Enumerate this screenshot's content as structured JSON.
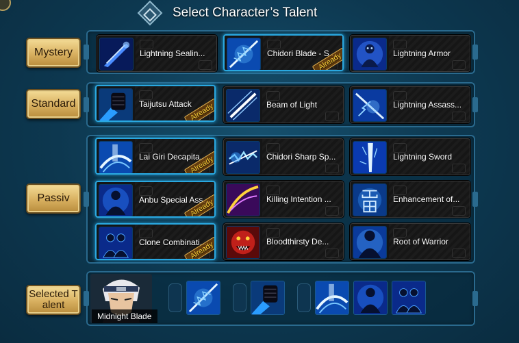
{
  "header": {
    "title": "Select Character’s Talent"
  },
  "categories": {
    "mystery": "Mystery",
    "standard": "Standard",
    "passive": "Passiv",
    "selected": "Selected T alent"
  },
  "already_label": "Already",
  "mystery_talents": [
    {
      "name": "Lightning Sealin...",
      "icon": "lightning-blade-icon",
      "selected": false,
      "already": false
    },
    {
      "name": "Chidori Blade - S...",
      "icon": "chidori-blade-icon",
      "selected": true,
      "already": true
    },
    {
      "name": "Lightning Armor",
      "icon": "lightning-armor-icon",
      "selected": false,
      "already": false
    }
  ],
  "standard_talents": [
    {
      "name": "Taijutsu Attack",
      "icon": "fist-icon",
      "selected": true,
      "already": true
    },
    {
      "name": "Beam of Light",
      "icon": "light-beam-icon",
      "selected": false,
      "already": false
    },
    {
      "name": "Lightning Assass...",
      "icon": "lightning-assassin-icon",
      "selected": false,
      "already": false
    }
  ],
  "passive_talents": [
    {
      "name": "Lai Giri Decapita...",
      "icon": "slash-icon",
      "selected": true,
      "already": true
    },
    {
      "name": "Chidori Sharp Sp...",
      "icon": "chidori-spear-icon",
      "selected": false,
      "already": false
    },
    {
      "name": "Lightning Sword",
      "icon": "lightning-sword-icon",
      "selected": false,
      "already": false
    },
    {
      "name": "Anbu Special Ass...",
      "icon": "anbu-silhouette-icon",
      "selected": true,
      "already": true
    },
    {
      "name": "Killing Intention ...",
      "icon": "killing-intent-icon",
      "selected": false,
      "already": false
    },
    {
      "name": "Enhancement of...",
      "icon": "thunder-kanji-icon",
      "selected": false,
      "already": false
    },
    {
      "name": "Clone Combinati...",
      "icon": "clone-icon",
      "selected": true,
      "already": true
    },
    {
      "name": "Bloodthirsty De...",
      "icon": "demon-face-icon",
      "selected": false,
      "already": false
    },
    {
      "name": "Root of Warrior",
      "icon": "warrior-silhouette-icon",
      "selected": false,
      "already": false
    }
  ],
  "selected_character": {
    "name": "Midnight Blade",
    "icon": "ninja-portrait-icon"
  },
  "selected_slots": [
    "chidori-blade-icon",
    "fist-icon",
    "slash-icon",
    "anbu-silhouette-icon",
    "clone-icon"
  ],
  "colors": {
    "background": "#0e3a52",
    "panel_border": "#2a6a8e",
    "gold_button": "#d8b060",
    "already_text": "#ffd23a",
    "selection_glow": "#2aa8e0"
  }
}
